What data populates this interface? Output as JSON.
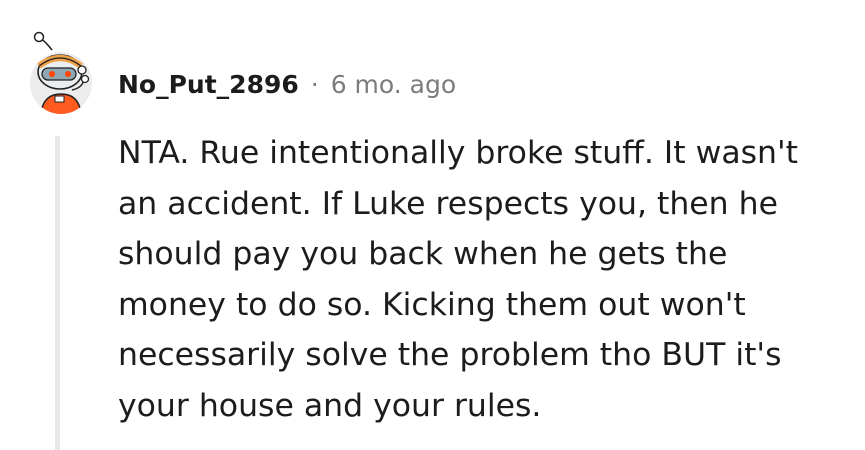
{
  "comment": {
    "author": "No_Put_2896",
    "separator": "·",
    "age": "6 mo. ago",
    "body_lines": [
      "NTA. Rue intentionally broke stuff. It wasn't",
      "an accident. If Luke respects you, then he",
      "should pay you back when he gets the",
      "money to do so. Kicking them out won't",
      "necessarily solve the problem tho BUT it's",
      "your house and your rules."
    ]
  },
  "icons": {
    "avatar": "snoo-avatar-icon"
  },
  "colors": {
    "text": "#1c1c1c",
    "meta": "#7c7c7c",
    "thread_line": "#e8e8e8",
    "avatar_bg": "#eeeeee",
    "snoo_orange": "#ff4500"
  }
}
